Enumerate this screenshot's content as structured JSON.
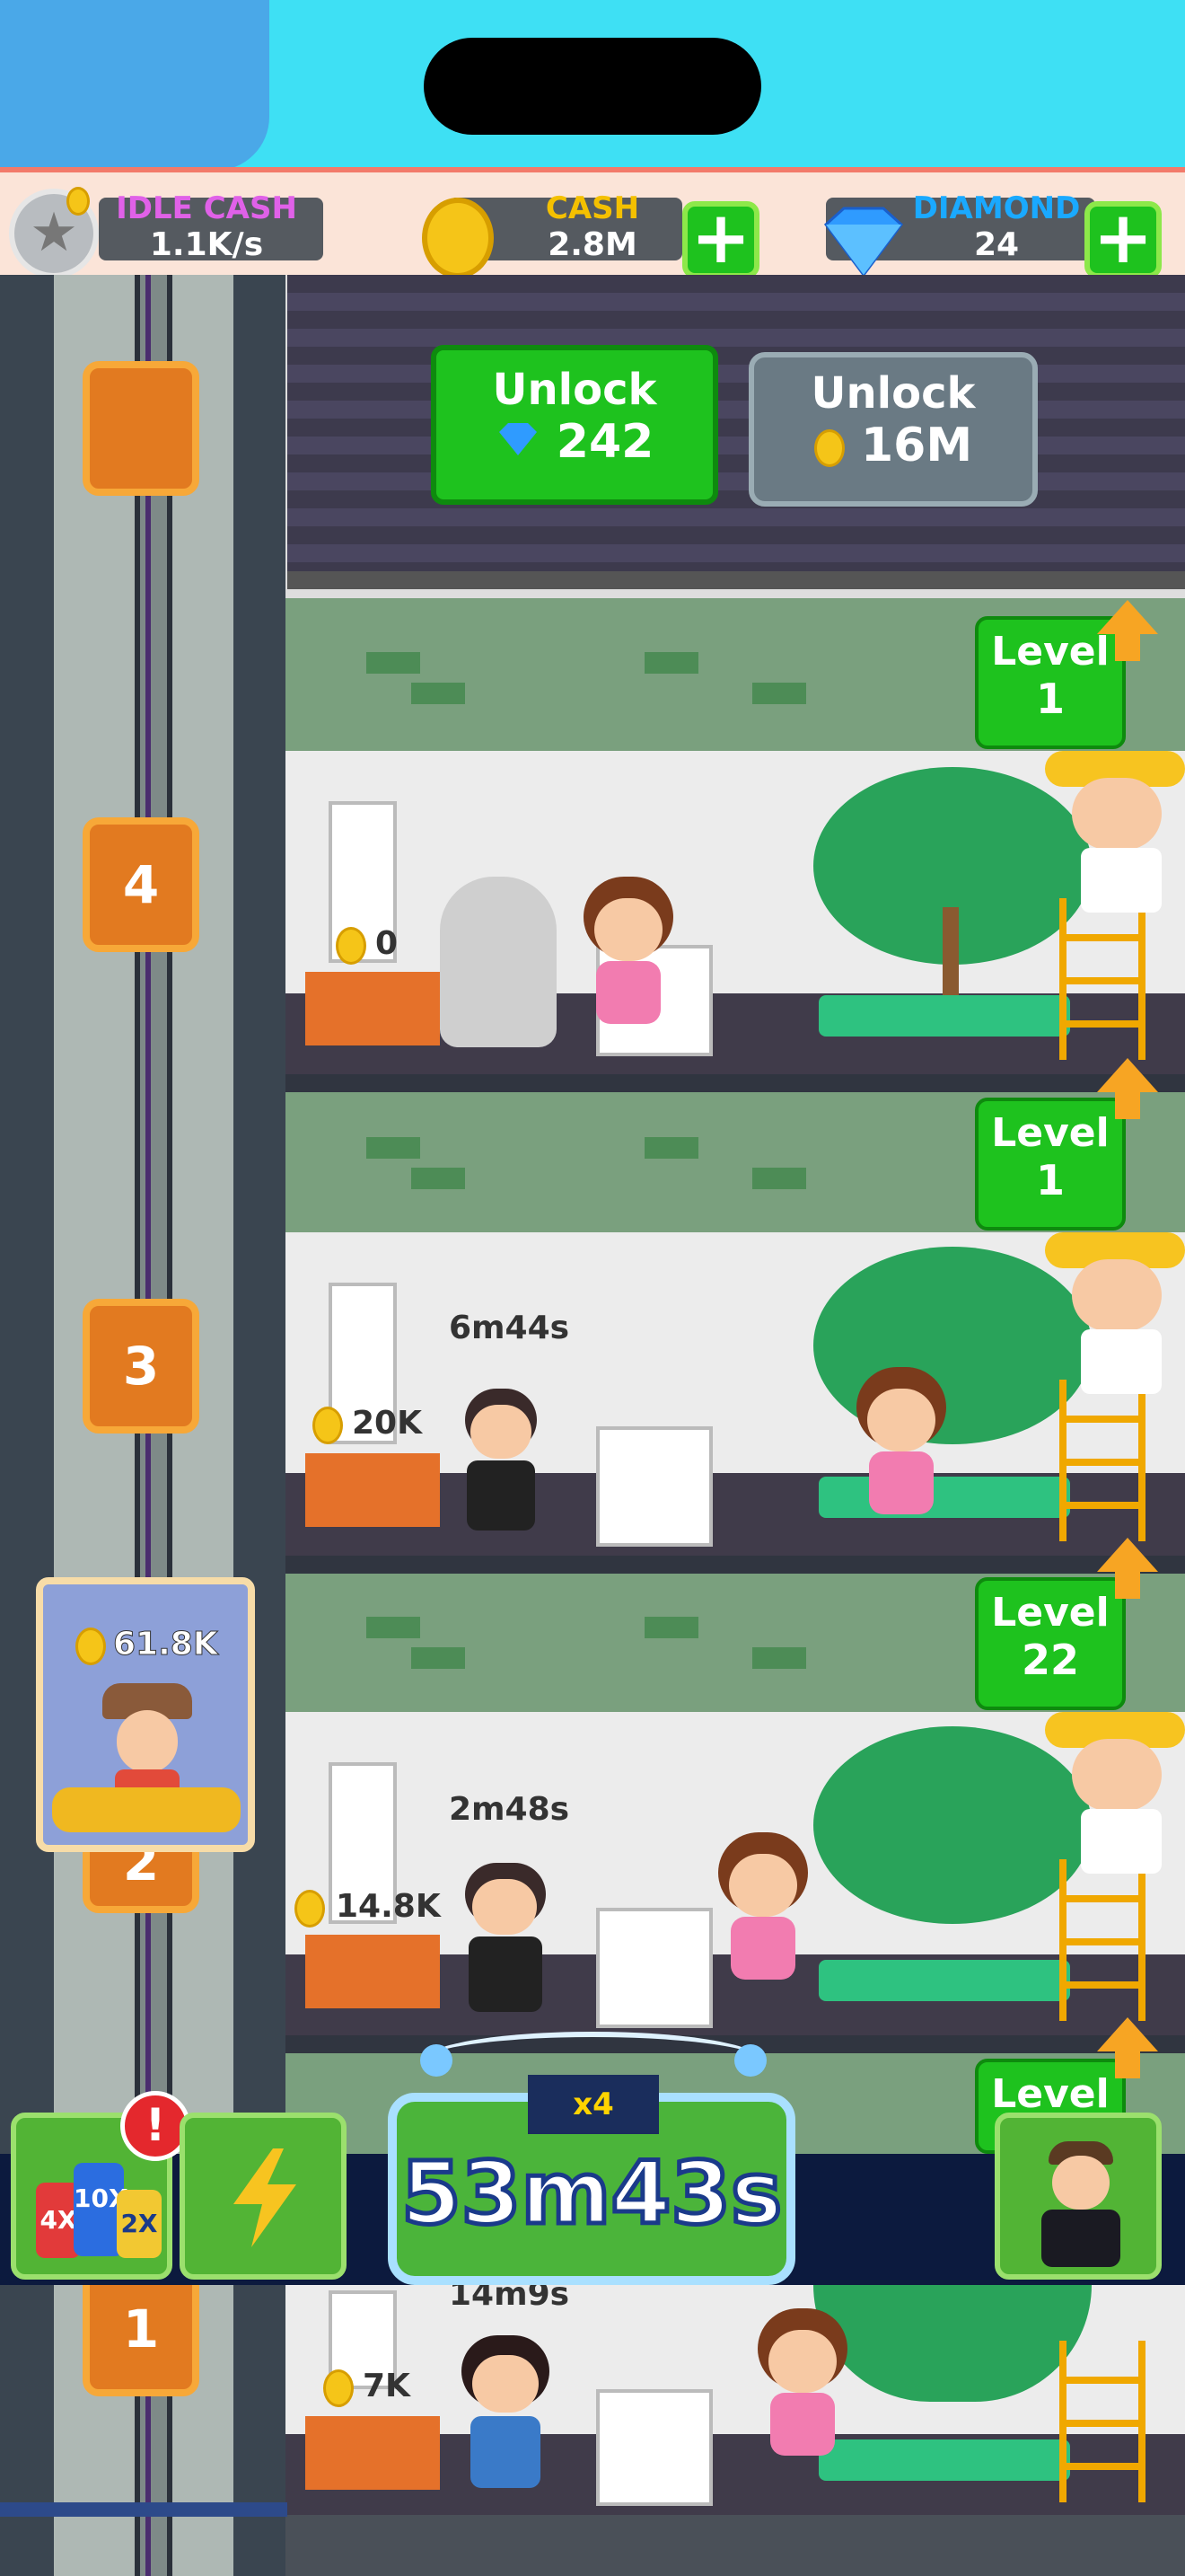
{
  "header": {
    "idle_cash_label": "IDLE CASH",
    "idle_cash_value": "1.1K/s",
    "cash_label": "CASH",
    "cash_value": "2.8M",
    "diamond_label": "DIAMOND",
    "diamond_value": "24",
    "plus_symbol": "+"
  },
  "unlock": {
    "diamond_button": {
      "title": "Unlock",
      "cost": "242",
      "icon": "diamond-icon"
    },
    "coin_button": {
      "title": "Unlock",
      "cost": "16M",
      "icon": "coin-icon"
    }
  },
  "floors": [
    {
      "number": "4",
      "level_label": "Level",
      "level": "1",
      "coins": "0",
      "timer": ""
    },
    {
      "number": "3",
      "level_label": "Level",
      "level": "1",
      "coins": "20K",
      "timer": "6m44s"
    },
    {
      "number": "2",
      "level_label": "Level",
      "level": "22",
      "coins": "14.8K",
      "timer": "2m48s"
    },
    {
      "number": "1",
      "level_label": "Level",
      "level": "",
      "coins": "7K",
      "timer": "14m9s"
    }
  ],
  "elevator": {
    "coins": "61.8K"
  },
  "boost": {
    "multiplier": "x4",
    "time_remaining": "53m43s",
    "potion_labels": [
      "4X",
      "10X",
      "2X"
    ],
    "alert": "!"
  },
  "colors": {
    "green": "#1ec21e",
    "orange": "#e27a20",
    "sky": "#3ee0f4",
    "navy": "#0c1a3e"
  }
}
